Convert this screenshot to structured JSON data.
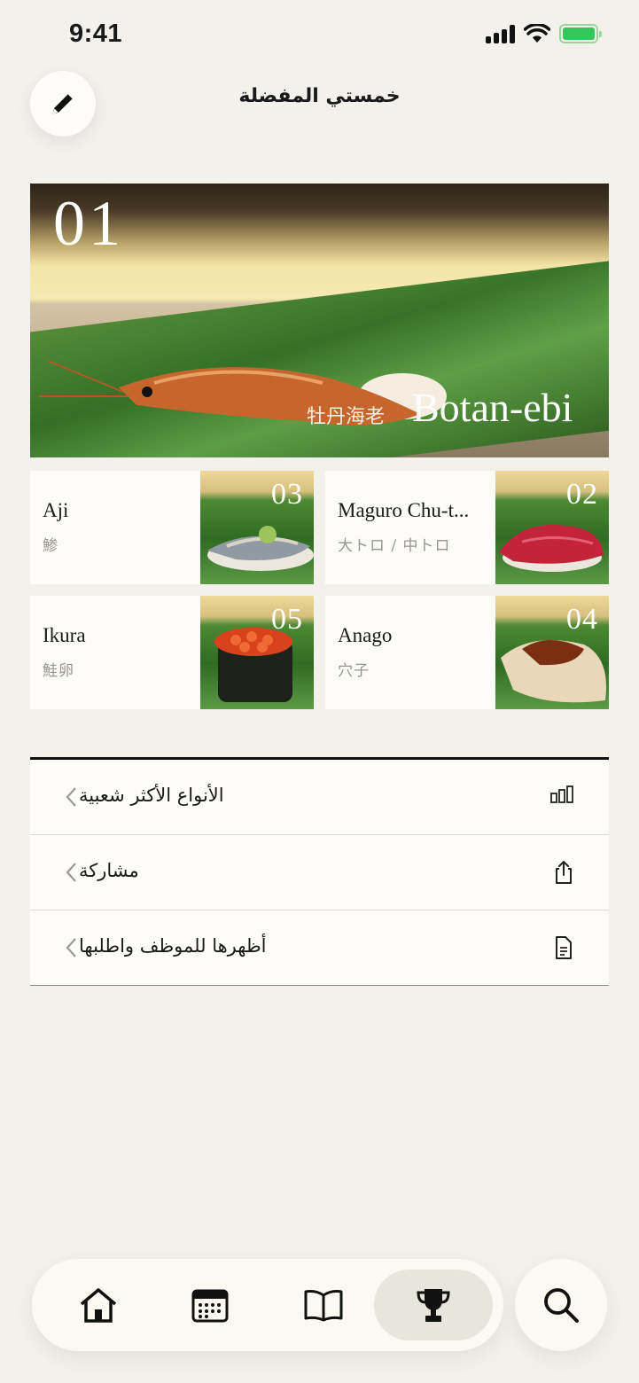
{
  "status_bar": {
    "time": "9:41"
  },
  "header": {
    "title": "خمستي المفضلة",
    "edit_icon": "pencil-icon"
  },
  "hero": {
    "rank": "01",
    "name_en": "Botan-ebi",
    "name_jp": "牡丹海老"
  },
  "cards": [
    {
      "rank": "03",
      "name": "Aji",
      "jp": "鯵"
    },
    {
      "rank": "02",
      "name": "Maguro Chu-t...",
      "jp": "大トロ / 中トロ"
    },
    {
      "rank": "05",
      "name": "Ikura",
      "jp": "鮭卵"
    },
    {
      "rank": "04",
      "name": "Anago",
      "jp": "穴子"
    }
  ],
  "menu": [
    {
      "label": "الأنواع الأكثر شعبية",
      "icon": "bar-chart-icon"
    },
    {
      "label": "مشاركة",
      "icon": "share-icon"
    },
    {
      "label": "أظهرها للموظف واطلبها",
      "icon": "document-icon"
    }
  ],
  "tabbar": {
    "tabs": [
      {
        "icon": "home-icon"
      },
      {
        "icon": "calendar-icon"
      },
      {
        "icon": "book-icon"
      },
      {
        "icon": "trophy-icon",
        "active": true
      }
    ],
    "search_icon": "search-icon"
  },
  "colors": {
    "background": "#f3f1ec",
    "surface": "#fdfcf8",
    "active_tab": "#e8e6dc",
    "battery": "#34c759"
  }
}
